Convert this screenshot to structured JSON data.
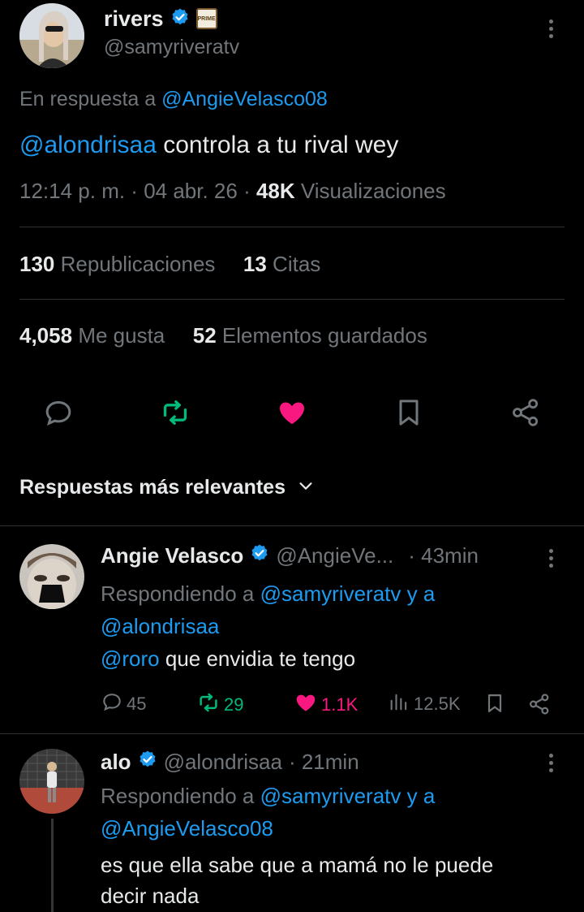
{
  "tweet": {
    "display_name": "rivers",
    "handle": "@samyriveratv",
    "prime_badge": "PRIME",
    "reply_prefix": "En respuesta a",
    "reply_to": "@AngieVelasco08",
    "mention": "@alondrisaa",
    "text": " controla a tu rival wey",
    "time": "12:14 p. m.",
    "date": "04 abr. 26",
    "views_count": "48K",
    "views_label": "Visualizaciones",
    "reposts_count": "130",
    "reposts_label": "Republicaciones",
    "quotes_count": "13",
    "quotes_label": "Citas",
    "likes_count": "4,058",
    "likes_label": "Me gusta",
    "bookmarks_count": "52",
    "bookmarks_label": "Elementos guardados"
  },
  "replies_header": "Respuestas más relevantes",
  "replies": [
    {
      "name": "Angie Velasco",
      "handle": "@AngieVe...",
      "time": "· 43min",
      "responding_prefix": "Respondiendo a",
      "responding_to": "@samyriveratv y a",
      "responding_to_2": "@alondrisaa",
      "mention": "@roro",
      "text": " que envidia te tengo",
      "replies": "45",
      "reposts": "29",
      "likes": "1.1K",
      "views": "12.5K"
    },
    {
      "name": "alo",
      "handle": "@alondrisaa",
      "time": "· 21min",
      "responding_prefix": "Respondiendo a",
      "responding_to": "@samyriveratv y a",
      "responding_to_2": "@AngieVelasco08",
      "text_line1": "es que ella sabe que a mamá no le puede",
      "text_line2": "decir nada"
    }
  ],
  "colors": {
    "background": "#000000",
    "text": "#e7e9ea",
    "muted": "#71767b",
    "link": "#1d9bf0",
    "repost": "#00ba7c",
    "like": "#f91880",
    "divider": "#2f3336"
  }
}
